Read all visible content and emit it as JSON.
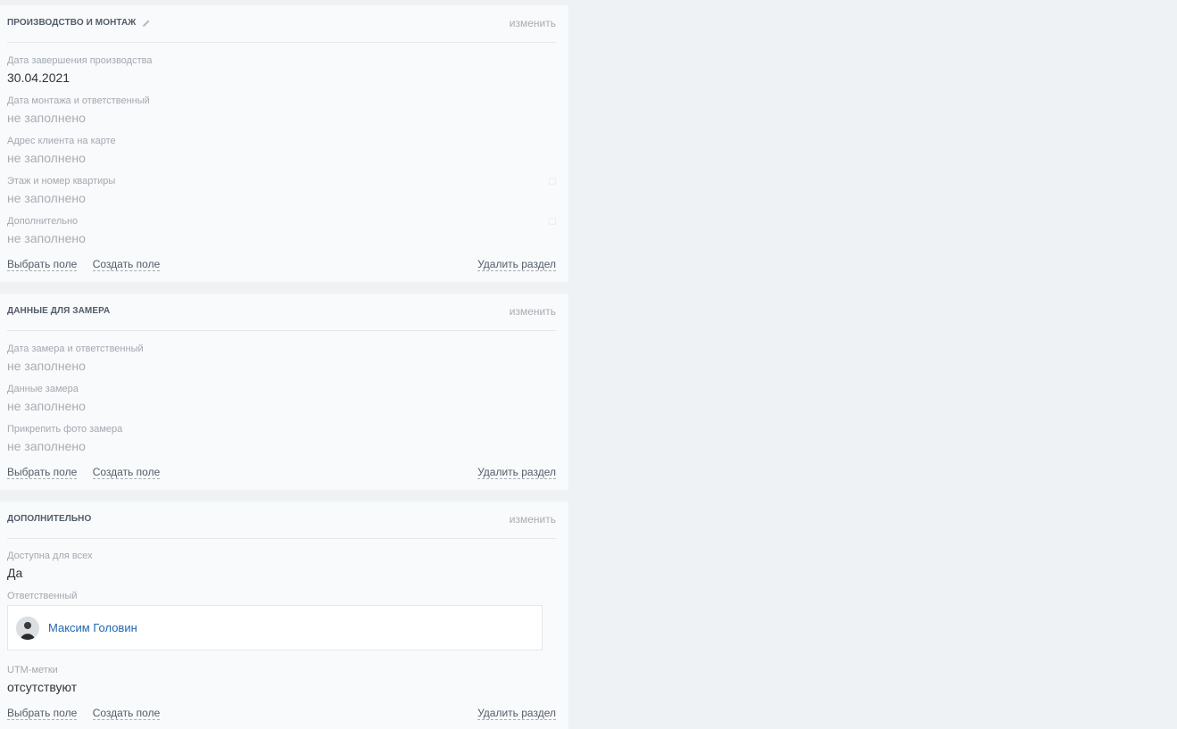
{
  "sections": [
    {
      "title": "ПРОИЗВОДСТВО И МОНТАЖ",
      "edit_label": "изменить",
      "fields": [
        {
          "label": "Дата завершения производства",
          "value": "30.04.2021"
        },
        {
          "label": "Дата монтажа и ответственный",
          "value": "не заполнено"
        },
        {
          "label": "Адрес клиента на карте",
          "value": "не заполнено"
        },
        {
          "label": "Этаж и номер квартиры",
          "value": "не заполнено"
        },
        {
          "label": "Дополнительно",
          "value": "не заполнено"
        }
      ],
      "footer": {
        "select_field": "Выбрать поле",
        "create_field": "Создать поле",
        "delete_section": "Удалить раздел"
      }
    },
    {
      "title": "ДАННЫЕ ДЛЯ ЗАМЕРА",
      "edit_label": "изменить",
      "fields": [
        {
          "label": "Дата замера и ответственный",
          "value": "не заполнено"
        },
        {
          "label": "Данные замера",
          "value": "не заполнено"
        },
        {
          "label": "Прикрепить фото замера",
          "value": "не заполнено"
        }
      ],
      "footer": {
        "select_field": "Выбрать поле",
        "create_field": "Создать поле",
        "delete_section": "Удалить раздел"
      }
    },
    {
      "title": "ДОПОЛНИТЕЛЬНО",
      "edit_label": "изменить",
      "fields": [
        {
          "label": "Доступна для всех",
          "value": "Да"
        },
        {
          "label": "Ответственный",
          "user_name": "Максим Головин"
        },
        {
          "label": "UTM-метки",
          "value": "отсутствуют"
        }
      ],
      "footer": {
        "select_field": "Выбрать поле",
        "create_field": "Создать поле",
        "delete_section": "Удалить раздел"
      }
    }
  ],
  "icons": {
    "edit_title": "pencil-icon",
    "avatar": "user-avatar"
  },
  "colors": {
    "background": "#eef2f4",
    "panel": "#f8fafb",
    "link": "#2067b0",
    "muted": "#a8adb4"
  }
}
